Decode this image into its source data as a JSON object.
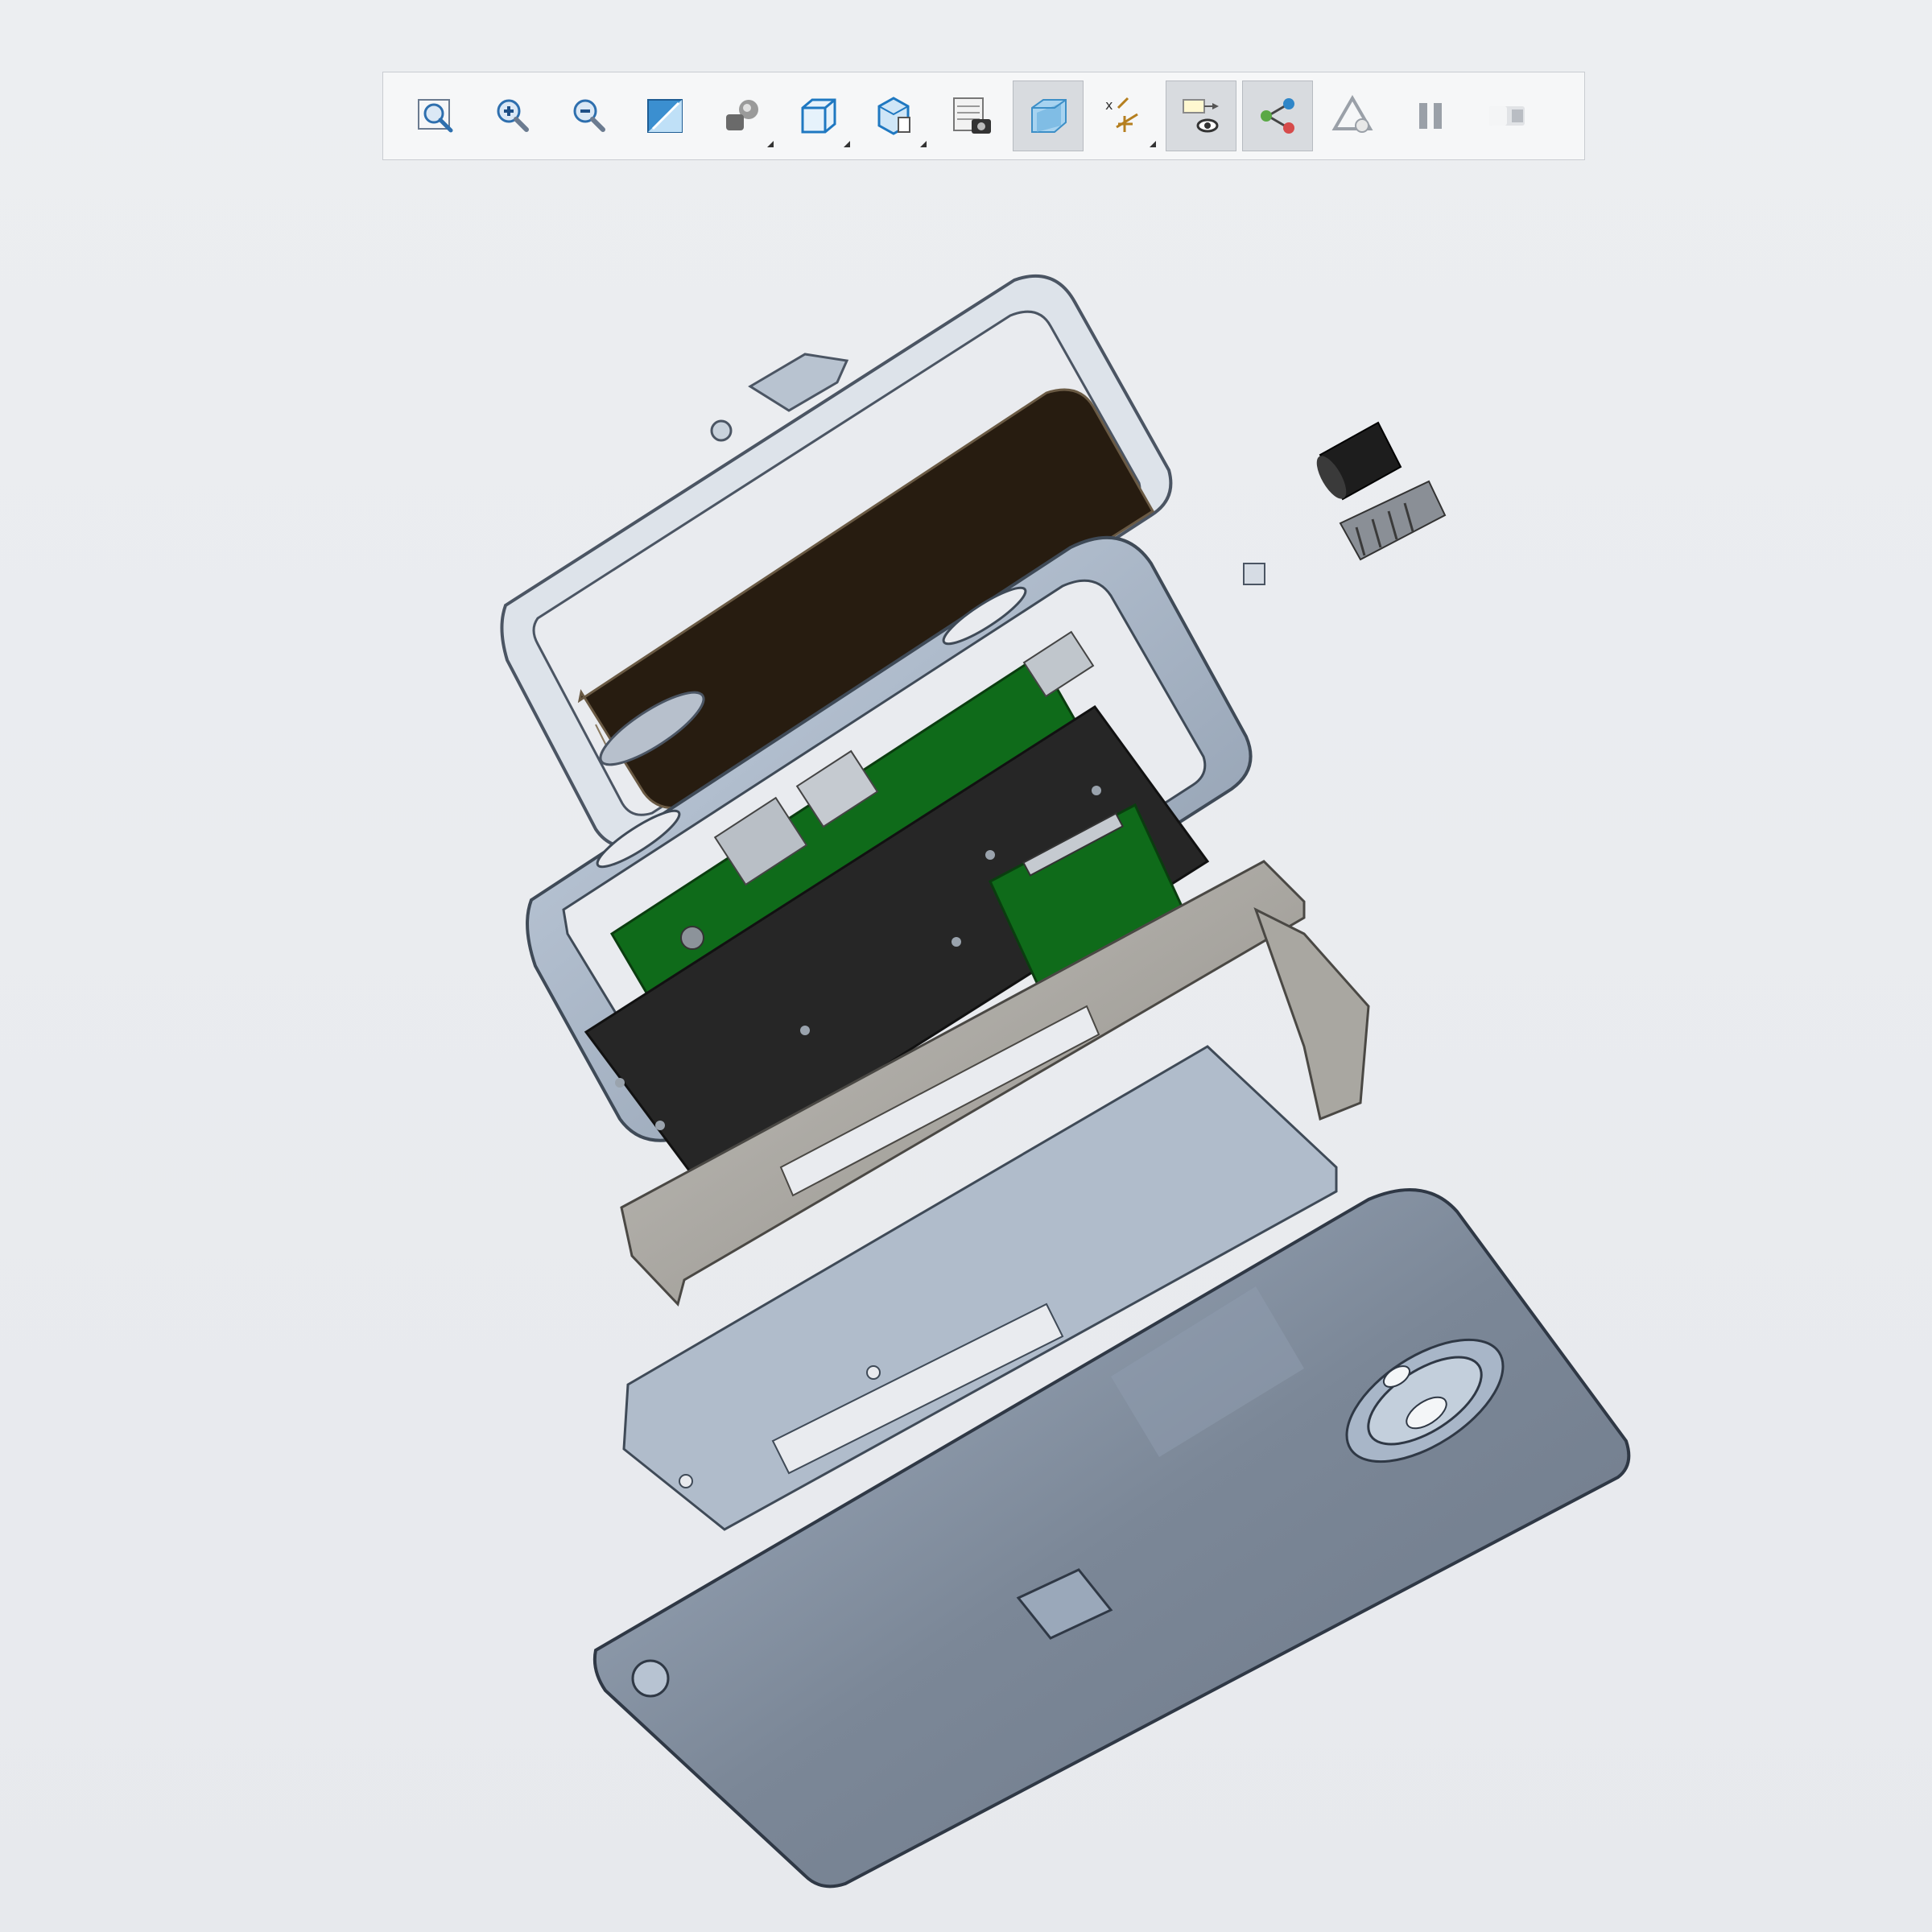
{
  "app": {
    "view": "3d-model-viewport"
  },
  "toolbar": {
    "buttons": [
      {
        "icon": "refit-icon",
        "active": false,
        "dropdown": false
      },
      {
        "icon": "zoom-in-icon",
        "active": false,
        "dropdown": false
      },
      {
        "icon": "zoom-out-icon",
        "active": false,
        "dropdown": false
      },
      {
        "icon": "repaint-icon",
        "active": false,
        "dropdown": false
      },
      {
        "icon": "display-style-icon",
        "active": false,
        "dropdown": true
      },
      {
        "icon": "saved-orientations-icon",
        "active": false,
        "dropdown": true
      },
      {
        "icon": "view-manager-icon",
        "active": false,
        "dropdown": true
      },
      {
        "icon": "perspective-snapshot-icon",
        "active": false,
        "dropdown": false
      },
      {
        "icon": "section-view-icon",
        "active": true,
        "dropdown": false
      },
      {
        "icon": "datum-display-icon",
        "active": false,
        "dropdown": true
      },
      {
        "icon": "annotation-display-icon",
        "active": true,
        "dropdown": false
      },
      {
        "icon": "explode-view-icon",
        "active": true,
        "dropdown": false
      },
      {
        "icon": "spin-center-icon",
        "active": false,
        "dropdown": false
      },
      {
        "icon": "pause-icon",
        "active": false,
        "dropdown": false
      },
      {
        "icon": "appearance-icon",
        "active": false,
        "dropdown": false
      }
    ]
  },
  "colors": {
    "background": "#e9ebef",
    "metal_light": "#aebdd0",
    "metal_dark": "#6e7b8c",
    "pcb_green": "#0f6b1a",
    "battery_dark": "#2a1f12",
    "shield_black": "#262626",
    "bracket_grey": "#a8a59f"
  }
}
